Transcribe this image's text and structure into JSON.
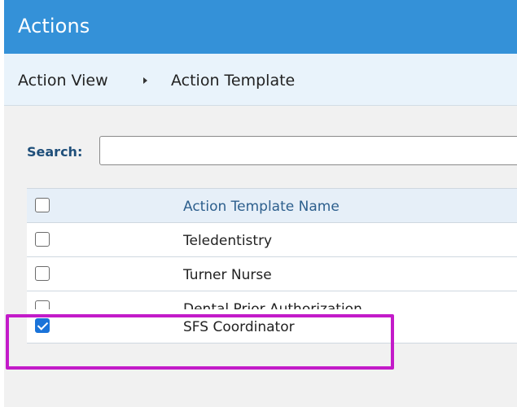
{
  "header": {
    "title": "Actions"
  },
  "breadcrumb": {
    "items": [
      "Action View",
      "Action Template"
    ]
  },
  "search": {
    "label": "Search:",
    "value": "",
    "placeholder": ""
  },
  "table": {
    "column_header": "Action Template Name",
    "rows": [
      {
        "name": "Teledentistry",
        "checked": false
      },
      {
        "name": "Turner Nurse",
        "checked": false
      },
      {
        "name": "Dental Prior Authorization",
        "checked": false
      },
      {
        "name": "SFS Coordinator",
        "checked": true
      }
    ]
  },
  "colors": {
    "header_bg": "#3491d8",
    "breadcrumb_bg": "#e9f3fb",
    "highlight": "#c31bc9",
    "checkbox_checked": "#1a73d9"
  }
}
